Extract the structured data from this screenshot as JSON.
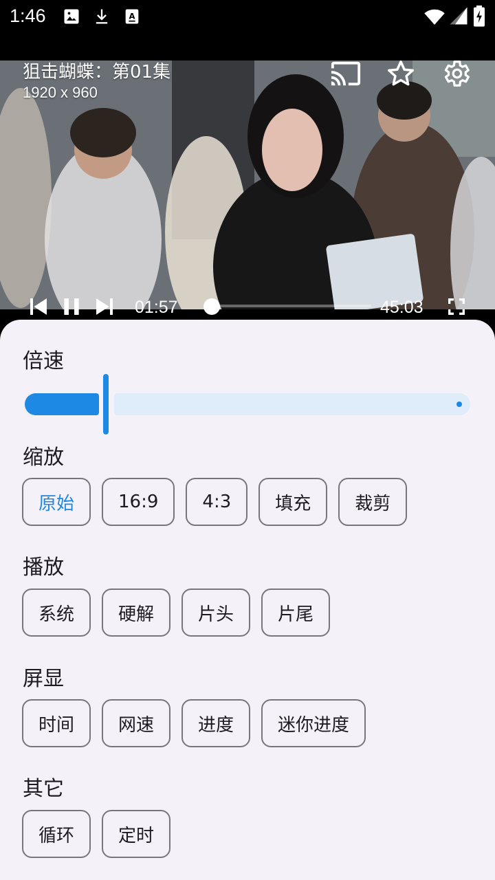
{
  "status_bar": {
    "time": "1:46",
    "icons": [
      "image-icon",
      "download-icon",
      "accessibility-icon",
      "wifi-icon",
      "signal-icon",
      "battery-charging-icon"
    ]
  },
  "player": {
    "title": "狙击蝴蝶：第01集",
    "resolution": "1920 x 960",
    "top_actions": [
      "cast-icon",
      "star-icon",
      "settings-icon"
    ],
    "current_time": "01:57",
    "duration": "45:03",
    "progress": 0.043,
    "controls": [
      "skip-previous-icon",
      "pause-icon",
      "skip-next-icon",
      "fullscreen-icon"
    ]
  },
  "settings": {
    "speed": {
      "title": "倍速",
      "value_fraction": 0.18,
      "accent": "#1e88e5"
    },
    "zoom": {
      "title": "缩放",
      "options": [
        "原始",
        "16:9",
        "4:3",
        "填充",
        "裁剪"
      ],
      "selected": "原始"
    },
    "play": {
      "title": "播放",
      "options": [
        "系统",
        "硬解",
        "片头",
        "片尾"
      ]
    },
    "display": {
      "title": "屏显",
      "options": [
        "时间",
        "网速",
        "进度",
        "迷你进度"
      ]
    },
    "other": {
      "title": "其它",
      "options": [
        "循环",
        "定时"
      ]
    }
  }
}
